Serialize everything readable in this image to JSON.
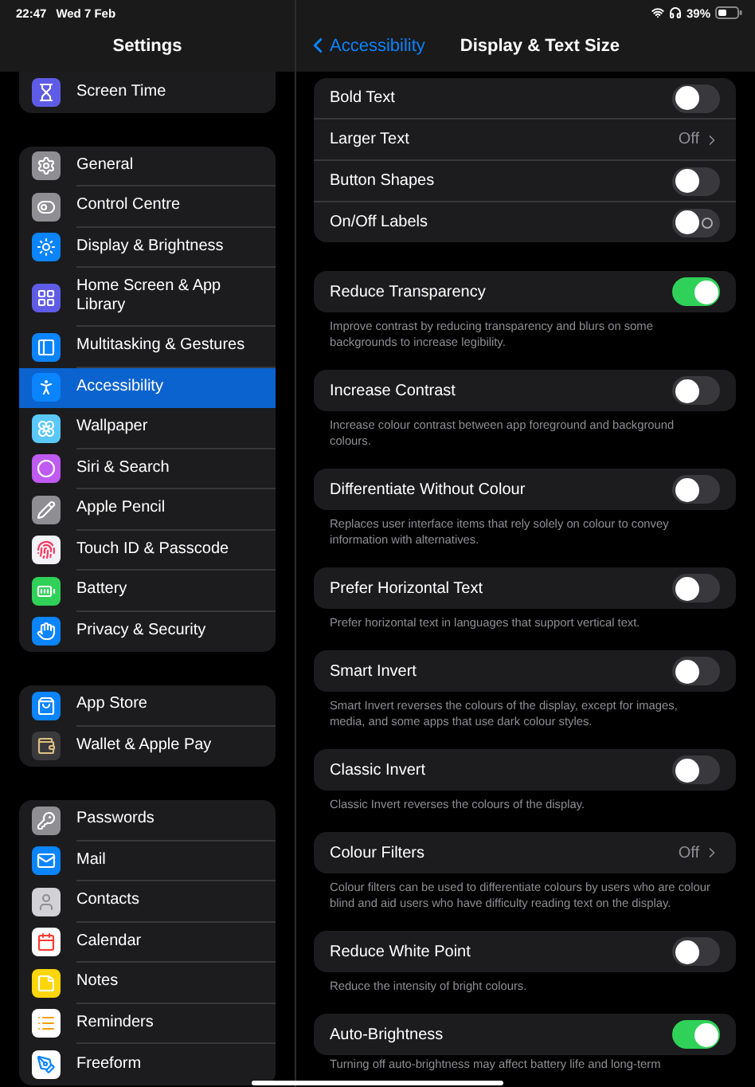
{
  "status_bar": {
    "time": "22:47",
    "date": "Wed 7 Feb",
    "battery": "39%"
  },
  "sidebar": {
    "title": "Settings",
    "groups": [
      {
        "items": [
          {
            "label": "Screen Time",
            "selected": false
          }
        ]
      },
      {
        "items": [
          {
            "label": "General",
            "selected": false
          },
          {
            "label": "Control Centre",
            "selected": false
          },
          {
            "label": "Display & Brightness",
            "selected": false
          },
          {
            "label": "Home Screen & App Library",
            "selected": false
          },
          {
            "label": "Multitasking & Gestures",
            "selected": false
          },
          {
            "label": "Accessibility",
            "selected": true
          },
          {
            "label": "Wallpaper",
            "selected": false
          },
          {
            "label": "Siri & Search",
            "selected": false
          },
          {
            "label": "Apple Pencil",
            "selected": false
          },
          {
            "label": "Touch ID & Passcode",
            "selected": false
          },
          {
            "label": "Battery",
            "selected": false
          },
          {
            "label": "Privacy & Security",
            "selected": false
          }
        ]
      },
      {
        "items": [
          {
            "label": "App Store",
            "selected": false
          },
          {
            "label": "Wallet & Apple Pay",
            "selected": false
          }
        ]
      },
      {
        "items": [
          {
            "label": "Passwords",
            "selected": false
          },
          {
            "label": "Mail",
            "selected": false
          },
          {
            "label": "Contacts",
            "selected": false
          },
          {
            "label": "Calendar",
            "selected": false
          },
          {
            "label": "Notes",
            "selected": false
          },
          {
            "label": "Reminders",
            "selected": false
          },
          {
            "label": "Freeform",
            "selected": false
          }
        ]
      }
    ]
  },
  "detail": {
    "back": "Accessibility",
    "title": "Display & Text Size",
    "sections": [
      {
        "rows": [
          {
            "kind": "toggle",
            "label": "Bold Text",
            "on": false
          },
          {
            "kind": "link",
            "label": "Larger Text",
            "value": "Off"
          },
          {
            "kind": "toggle",
            "label": "Button Shapes",
            "on": false
          },
          {
            "kind": "toggle",
            "label": "On/Off Labels",
            "on": false,
            "labels": true
          }
        ]
      },
      {
        "rows": [
          {
            "kind": "toggle",
            "label": "Reduce Transparency",
            "on": true
          }
        ],
        "footer": "Improve contrast by reducing transparency and blurs on some backgrounds to increase legibility."
      },
      {
        "rows": [
          {
            "kind": "toggle",
            "label": "Increase Contrast",
            "on": false
          }
        ],
        "footer": "Increase colour contrast between app foreground and background colours."
      },
      {
        "rows": [
          {
            "kind": "toggle",
            "label": "Differentiate Without Colour",
            "on": false
          }
        ],
        "footer": "Replaces user interface items that rely solely on colour to convey information with alternatives."
      },
      {
        "rows": [
          {
            "kind": "toggle",
            "label": "Prefer Horizontal Text",
            "on": false
          }
        ],
        "footer": "Prefer horizontal text in languages that support vertical text."
      },
      {
        "rows": [
          {
            "kind": "toggle",
            "label": "Smart Invert",
            "on": false
          }
        ],
        "footer": "Smart Invert reverses the colours of the display, except for images, media, and some apps that use dark colour styles."
      },
      {
        "rows": [
          {
            "kind": "toggle",
            "label": "Classic Invert",
            "on": false
          }
        ],
        "footer": "Classic Invert reverses the colours of the display."
      },
      {
        "rows": [
          {
            "kind": "link",
            "label": "Colour Filters",
            "value": "Off"
          }
        ],
        "footer": "Colour filters can be used to differentiate colours by users who are colour blind and aid users who have difficulty reading text on the display."
      },
      {
        "rows": [
          {
            "kind": "toggle",
            "label": "Reduce White Point",
            "on": false
          }
        ],
        "footer": "Reduce the intensity of bright colours."
      },
      {
        "rows": [
          {
            "kind": "toggle",
            "label": "Auto-Brightness",
            "on": true
          }
        ],
        "footer": "Turning off auto-brightness may affect battery life and long-term"
      }
    ]
  }
}
